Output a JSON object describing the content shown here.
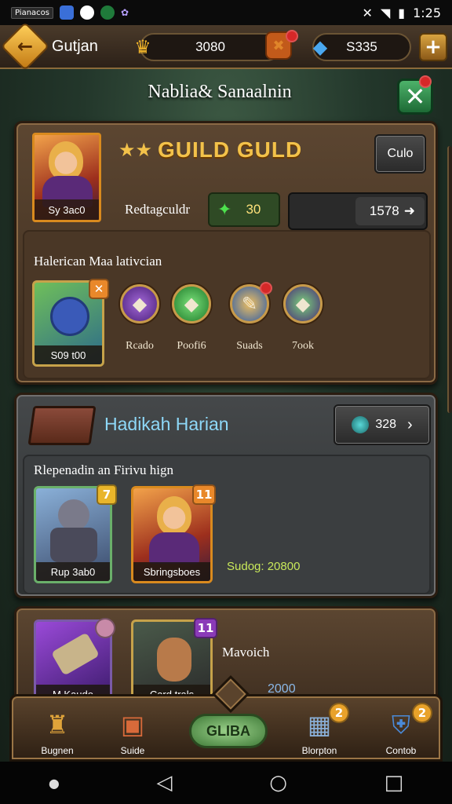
{
  "status_bar": {
    "left_chip": "Pianacos",
    "time": "1:25"
  },
  "top_bar": {
    "title": "Gutjan",
    "gold_amount": "3080",
    "gem_amount": "S335"
  },
  "heading": "Nablia& Sanaalnin",
  "guild_panel": {
    "portrait_caption": "Sy 3ac0",
    "guild_name": "GUILD GULD",
    "side_button": "Culo",
    "reward_label": "Redtagculdr",
    "reward_value": "30",
    "reward_right_value": "1578",
    "section_label": "Halerican Maa lativcian",
    "featured_item_caption": "S09 t00",
    "items": [
      {
        "label": "Rcado"
      },
      {
        "label": "Poofi6"
      },
      {
        "label": "Suads"
      },
      {
        "label": "7ook"
      }
    ]
  },
  "daily_panel": {
    "title": "Hadikah Harian",
    "currency_value": "328",
    "subtitle": "Rlepenadin an Firivu hign",
    "cards": [
      {
        "caption": "Rup 3ab0",
        "badge": "7"
      },
      {
        "caption": "Sbringsboes",
        "badge": "11"
      }
    ],
    "reward_text": "Sudog: 20800"
  },
  "third_panel": {
    "cards": [
      {
        "caption": "M Kaudo",
        "badge": ""
      },
      {
        "caption": "Card trals",
        "badge": "11"
      }
    ],
    "label": "Mavoich",
    "amount": "2000"
  },
  "bottom_nav": {
    "items": [
      {
        "label": "Bugnen"
      },
      {
        "label": "Suide"
      },
      {
        "label": "Blorpton"
      },
      {
        "label": "Contob"
      }
    ],
    "center_label": "GLIBA",
    "badges": [
      "2",
      "2"
    ]
  },
  "colors": {
    "gold": "#f3c24a",
    "panel_brown": "#5c4631",
    "panel_gray": "#45484a",
    "accent_green": "#4db26a",
    "notify_red": "#d62828"
  },
  "icons": [
    "back-arrow-icon",
    "crown-icon",
    "chest-icon",
    "diamond-icon",
    "plus-icon",
    "close-icon",
    "star-icon",
    "sword-icon",
    "gem-icon",
    "book-icon",
    "helmet-icon"
  ]
}
